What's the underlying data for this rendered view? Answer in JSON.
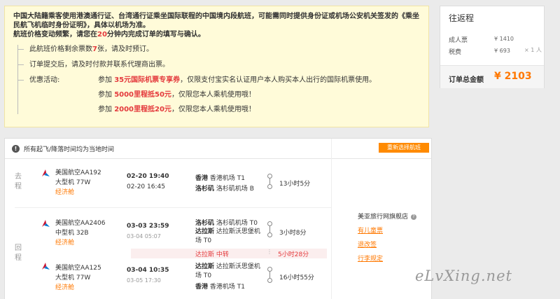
{
  "notice": {
    "para1": "中国大陆籍乘客使用港澳通行证、台湾通行证乘坐国际联程的中国境内段航班，可能需同时提供身份证或机场公安机关签发的《乘坐民航飞机临时身份证明》，具体以机场为准。",
    "para2_pre": "航班价格变动频繁，请您在",
    "para2_num": "20",
    "para2_post": "分钟内完成订单的填写与确认。",
    "remain_pre": "此航班价格剩余票数",
    "remain_num": "7",
    "remain_post": "张，请及时预订。",
    "pay": "订单提交后，请及时付款并联系代理商出票。",
    "promo_label": "优惠活动:",
    "promo1_pre": "参加",
    "promo1_hl": "35元国际机票专享券",
    "promo1_post": "，仅限支付宝实名认证用户本人购买本人出行的国际机票使用。",
    "promo2_pre": "参加",
    "promo2_hl": "5000里程抵50元",
    "promo2_post": "，仅限您本人乘机使用哦！",
    "promo3_pre": "参加",
    "promo3_hl": "2000里程抵20元",
    "promo3_post": "，仅限您本人乘机使用哦！"
  },
  "price": {
    "title": "往返程",
    "adult_label": "成人票",
    "adult_value": "¥ 1410",
    "tax_label": "税费",
    "tax_value": "¥ 693",
    "times": "× 1 人",
    "total_label": "订单总金额",
    "total_value": "¥ 2103"
  },
  "flights": {
    "header": "所有起飞/降落时间均为当地时间",
    "reselect": "重新选择航班",
    "outbound": {
      "direction": "去程",
      "airline": "美国航空AA192",
      "aircraft": "大型机 77W",
      "cabin": "经济舱",
      "dep_time": "02-20 19:40",
      "arr_time": "02-20 16:45",
      "dep_city": "香港",
      "dep_airport": "香港机场 T1",
      "arr_city": "洛杉矶",
      "arr_airport": "洛杉矶机场 B",
      "duration": "13小时5分"
    },
    "return": {
      "direction": "回程",
      "leg1": {
        "airline": "美国航空AA2406",
        "aircraft": "中型机 32B",
        "cabin": "经济舱",
        "dep_time": "03-03 23:59",
        "arr_time": "03-04 05:07",
        "dep_city": "洛杉矶",
        "dep_airport": "洛杉矶机场 T0",
        "arr_city": "达拉斯",
        "arr_airport": "达拉斯沃思堡机场 T0",
        "duration": "3小时8分"
      },
      "transfer_city": "达拉斯",
      "transfer_label": "中转",
      "transfer_duration": "5小时28分",
      "leg2": {
        "airline": "美国航空AA125",
        "aircraft": "大型机 77W",
        "cabin": "经济舱",
        "dep_time": "03-04 10:35",
        "arr_time": "03-05 17:30",
        "dep_city": "达拉斯",
        "dep_airport": "达拉斯沃思堡机场 T0",
        "arr_city": "香港",
        "arr_airport": "香港机场 T1",
        "duration": "16小时55分"
      }
    }
  },
  "agent": {
    "store": "美亚旅行网旗舰店",
    "links": [
      "有儿童票",
      "退改签",
      "行李规定"
    ]
  },
  "watermark": "eLvXing.net",
  "colors": {
    "accent": "#ff7800",
    "highlight": "#e4393c",
    "notice_bg": "#fffbd9"
  }
}
